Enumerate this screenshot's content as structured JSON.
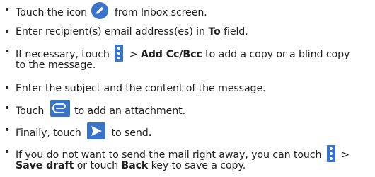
{
  "bullet_char": "•",
  "colors": {
    "text": "#1f1f1f",
    "icon_blue": "#3a74c9"
  },
  "icons": {
    "compose": "pencil-compose-icon",
    "menu": "overflow-menu-icon",
    "attach": "paperclip-attach-icon",
    "send": "send-arrow-icon"
  },
  "steps": {
    "s1": {
      "a": "Touch the icon",
      "b": "from Inbox screen."
    },
    "s2": {
      "a": "Enter recipient(s) email address(es) in",
      "bold": "To",
      "b": "field."
    },
    "s3": {
      "a": "If necessary, touch",
      "b": ">",
      "bold": "Add Cc/Bcc",
      "c": "to add a copy or a blind copy",
      "line2": "to the message."
    },
    "s4": {
      "a": "Enter the subject and the content of the message."
    },
    "s5": {
      "a": "Touch",
      "b": "to add an attachment."
    },
    "s6": {
      "a": "Finally, touch",
      "b": "to send",
      "c": "."
    },
    "s7": {
      "a": "If you do not want to send the mail right away, you can touch",
      "b": ">",
      "bold1": "Save draft",
      "c": "or touch",
      "bold2": "Back",
      "d": "key to save a copy."
    }
  }
}
